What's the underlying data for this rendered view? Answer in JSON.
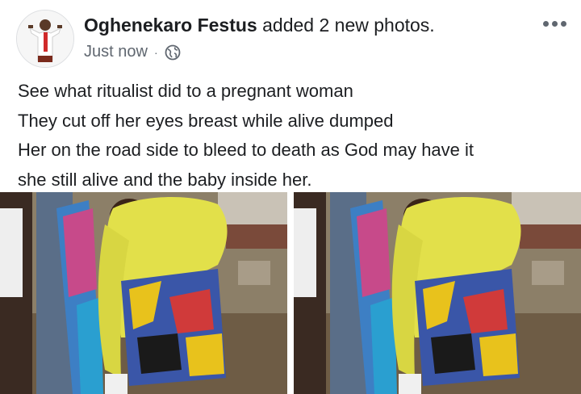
{
  "post": {
    "author": "Oghenekaro Festus",
    "action": " added 2 new photos.",
    "timestamp": "Just now",
    "separator": "·",
    "privacy_icon": "globe-icon",
    "more_icon": "more-options-icon",
    "text_lines": [
      "See what ritualist did to a pregnant woman",
      "They cut off her eyes breast while alive dumped",
      "Her on the road side to bleed to death as God may have it",
      "she still alive and the baby inside her."
    ],
    "photos": [
      {
        "icon": "photo-woman-bending"
      },
      {
        "icon": "photo-woman-bending-duplicate"
      }
    ]
  },
  "colors": {
    "author_text": "#1c1e21",
    "meta_text": "#606770",
    "background": "#ffffff",
    "lace_top": "#e2e04a",
    "skirt_blue": "#3a56a8",
    "skirt_yellow": "#e8c21c"
  }
}
